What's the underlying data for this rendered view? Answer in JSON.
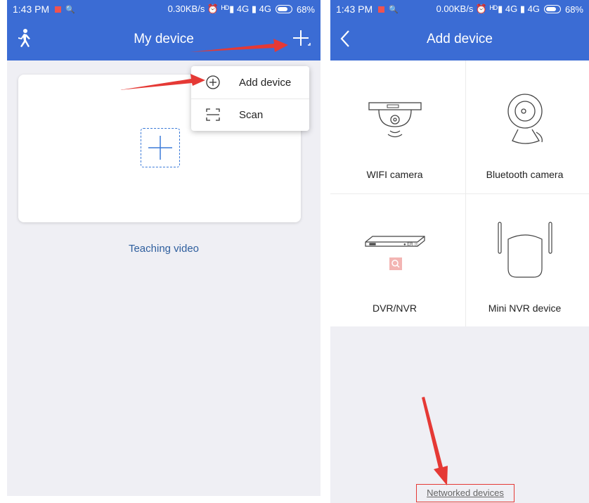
{
  "left_screen": {
    "status": {
      "time": "1:43 PM",
      "right": "0.30KB/s ⏰ ᴴᴰ▮ 4G ▮ 4G",
      "battery": "68%"
    },
    "title": "My device",
    "dropdown": [
      {
        "label": "Add device",
        "icon": "plus-circle-icon"
      },
      {
        "label": "Scan",
        "icon": "scan-icon"
      }
    ],
    "teaching_video": "Teaching video"
  },
  "right_screen": {
    "status": {
      "time": "1:43 PM",
      "right": "0.00KB/s ⏰ ᴴᴰ▮ 4G ▮ 4G",
      "battery": "68%"
    },
    "title": "Add device",
    "devices": [
      {
        "label": "WIFI camera",
        "icon": "wifi-camera-icon"
      },
      {
        "label": "Bluetooth camera",
        "icon": "bluetooth-camera-icon"
      },
      {
        "label": "DVR/NVR",
        "icon": "dvr-icon"
      },
      {
        "label": "Mini NVR device",
        "icon": "mini-nvr-icon"
      }
    ],
    "networked_devices": "Networked devices"
  },
  "colors": {
    "header": "#3b6cd4",
    "accent": "#3b7ad8",
    "annotation": "#e53935",
    "link": "#2f5f9e"
  }
}
